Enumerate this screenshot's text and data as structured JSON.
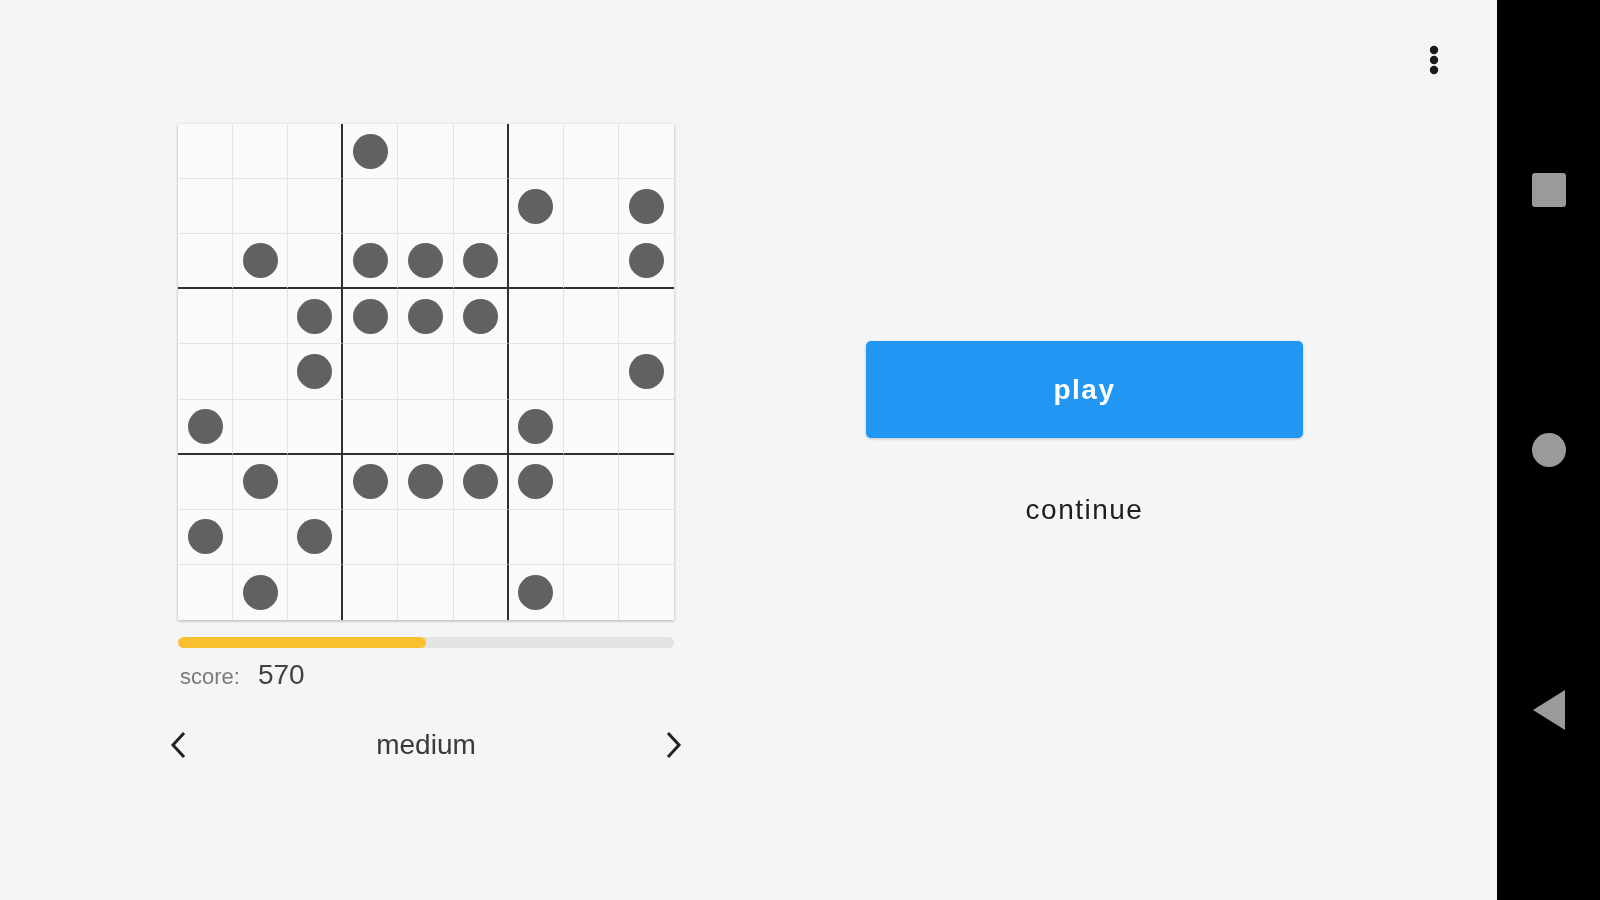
{
  "board": {
    "rows": [
      [
        false,
        false,
        false,
        true,
        false,
        false,
        false,
        false,
        false
      ],
      [
        false,
        false,
        false,
        false,
        false,
        false,
        true,
        false,
        true
      ],
      [
        false,
        true,
        false,
        true,
        true,
        true,
        false,
        false,
        true
      ],
      [
        false,
        false,
        true,
        true,
        true,
        true,
        false,
        false,
        false
      ],
      [
        false,
        false,
        true,
        false,
        false,
        false,
        false,
        false,
        true
      ],
      [
        true,
        false,
        false,
        false,
        false,
        false,
        true,
        false,
        false
      ],
      [
        false,
        true,
        false,
        true,
        true,
        true,
        true,
        false,
        false
      ],
      [
        true,
        false,
        true,
        false,
        false,
        false,
        false,
        false,
        false
      ],
      [
        false,
        true,
        false,
        false,
        false,
        false,
        true,
        false,
        false
      ]
    ]
  },
  "progress": {
    "level": 0.5
  },
  "score": {
    "label": "score:",
    "value": "570"
  },
  "difficulty": {
    "label": "medium"
  },
  "actions": [
    {
      "kind": "primary",
      "label": "play"
    },
    {
      "kind": "text",
      "label": "continue"
    }
  ]
}
